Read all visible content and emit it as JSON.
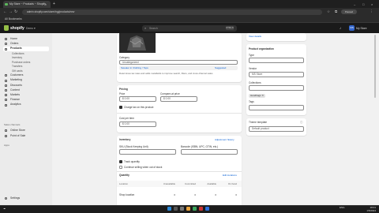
{
  "browser": {
    "tab_title": "My Store ~ Products ~ Shopify",
    "url": "admin.shopify.com/store/rhgj/products/new",
    "bookmark": "All Bookmarks",
    "profile": "Paused"
  },
  "topbar": {
    "logo": "shopify",
    "store_dropdown": "Demo ▾",
    "search_placeholder": "Search",
    "search_shortcut": "CTRL K",
    "avatar": "MS",
    "store_name": "My Store"
  },
  "sidebar": {
    "items": [
      {
        "label": "Home",
        "icon": "home-icon"
      },
      {
        "label": "Orders",
        "icon": "orders-icon"
      },
      {
        "label": "Products",
        "icon": "tag-icon",
        "active": true
      },
      {
        "label": "Collections",
        "sub": true
      },
      {
        "label": "Inventory",
        "sub": true
      },
      {
        "label": "Purchase orders",
        "sub": true
      },
      {
        "label": "Transfers",
        "sub": true
      },
      {
        "label": "Gift cards",
        "sub": true
      },
      {
        "label": "Customers",
        "icon": "person-icon"
      },
      {
        "label": "Marketing",
        "icon": "target-icon"
      },
      {
        "label": "Discounts",
        "icon": "discount-icon"
      },
      {
        "label": "Content",
        "icon": "content-icon"
      },
      {
        "label": "Markets",
        "icon": "globe-icon"
      },
      {
        "label": "Finance",
        "icon": "bank-icon"
      },
      {
        "label": "Analytics",
        "icon": "chart-icon"
      }
    ],
    "sales_heading": "Sales channels",
    "sales_items": [
      {
        "label": "Online Store",
        "icon": "store-icon"
      },
      {
        "label": "Point of Sale",
        "icon": "pos-icon"
      }
    ],
    "apps_heading": "Apps",
    "settings_label": "Settings"
  },
  "media": {
    "category_label": "Category",
    "category_value": "Uncategorized",
    "category_suggestion": "Sweater in Clothing / Tops",
    "category_suggestion_action": "Suggested",
    "category_help": "Determines tax rates and adds metafields to improve search, filters, and cross-channel sales"
  },
  "pricing": {
    "title": "Pricing",
    "price_label": "Price",
    "price_value": "$ 0.00",
    "compare_label": "Compare-at price",
    "compare_value": "$ 0.00",
    "charge_tax_label": "Charge tax on this product",
    "cost_label": "Cost per item",
    "cost_value": "$ 0.00"
  },
  "inventory": {
    "title": "Inventory",
    "adjustment_link": "Adjustment history",
    "sku_label": "SKU (Stock Keeping Unit)",
    "barcode_label": "Barcode (ISBN, UPC, GTIN, etc.)",
    "track_label": "Track quantity",
    "continue_label": "Continue selling when out of stock",
    "quantity_label": "Quantity",
    "edit_locations_link": "Edit locations",
    "columns": [
      "Location",
      "Unavailable",
      "Committed",
      "Available",
      "On hand"
    ],
    "rows": [
      {
        "location": "Shop location",
        "values": [
          "0",
          "0",
          "0",
          "0"
        ]
      }
    ]
  },
  "organization": {
    "top_link": "View details",
    "title": "Product organization",
    "type_label": "Type",
    "vendor_label": "Vendor",
    "vendor_value": "MS Store",
    "collections_label": "Collections",
    "collection_tag": "Handbags ✕",
    "tags_label": "Tags",
    "theme_label": "Theme template",
    "theme_value": "Default product"
  },
  "taskbar": {
    "time": "18:01",
    "date": "1/5/2024",
    "lang": "ENG"
  }
}
